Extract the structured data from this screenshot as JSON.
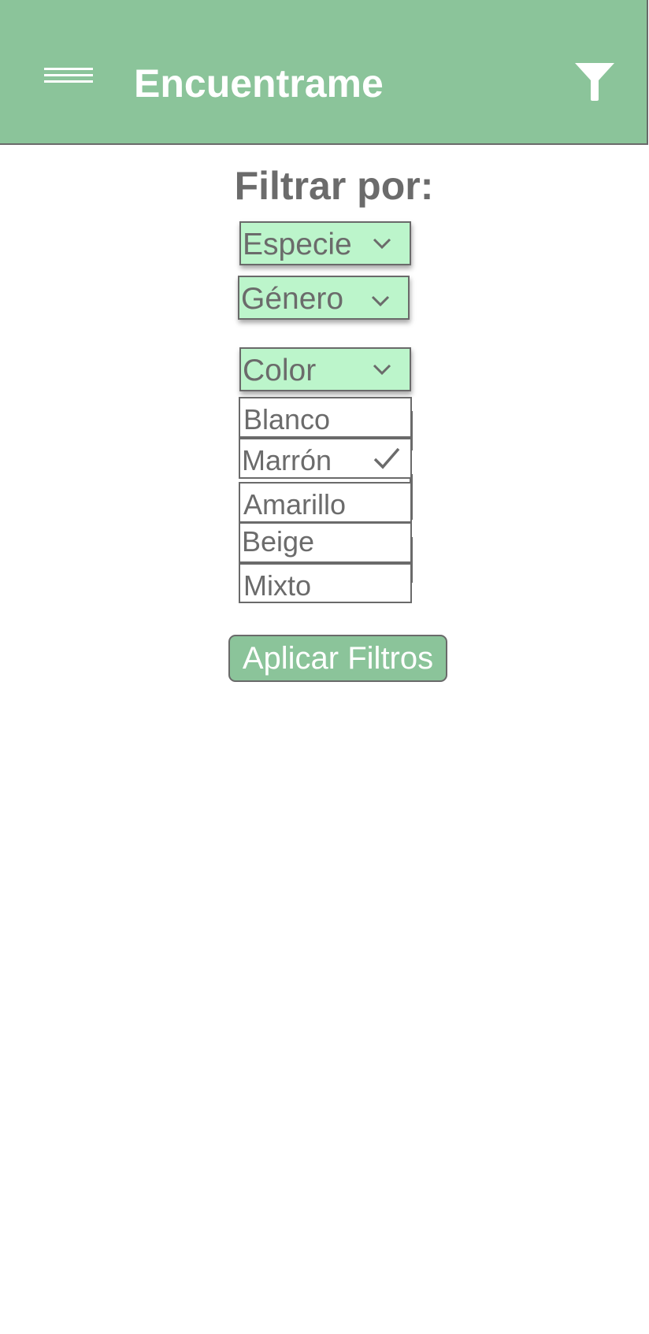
{
  "app_bar": {
    "title": "Encuentrame",
    "menu_icon": "hamburger-menu-icon",
    "filter_icon": "funnel-filter-icon",
    "background_color": "#8bc49a",
    "text_color": "#ffffff"
  },
  "filters": {
    "heading": "Filtrar por:",
    "selects": [
      {
        "label": "Especie",
        "icon": "chevron-down-icon"
      },
      {
        "label": "Género",
        "icon": "chevron-down-icon"
      },
      {
        "label": "Color",
        "icon": "chevron-down-icon",
        "expanded": true
      }
    ],
    "select_background_color": "#bcf5cb",
    "color_options": [
      {
        "label": "Blanco",
        "selected": false
      },
      {
        "label": "Marrón",
        "selected": true,
        "icon": "checkmark-icon"
      },
      {
        "label": "Amarillo",
        "selected": false
      },
      {
        "label": "Beige",
        "selected": false
      },
      {
        "label": "Mixto",
        "selected": false
      }
    ],
    "apply_button_label": "Aplicar Filtros"
  },
  "colors": {
    "accent": "#8bc49a",
    "text_gray": "#6b6b6b",
    "border_gray": "#6a6a6a"
  }
}
